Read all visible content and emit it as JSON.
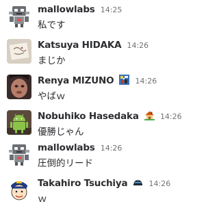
{
  "messages": [
    {
      "user": "mallowlabs",
      "time": "14:25",
      "text": "私です",
      "avatar_icon": "robot-avatar"
    },
    {
      "user": "Katsuya HIDAKA",
      "time": "14:26",
      "text": "まじか",
      "avatar_icon": "sketch-avatar"
    },
    {
      "user": "Renya MIZUNO",
      "time": "14:26",
      "text": "やばｗ",
      "avatar_icon": "photo-avatar",
      "status_icon": "pixel-art-icon"
    },
    {
      "user": "Nobuhiko Hasedaka",
      "time": "14:26",
      "text": "優勝じゃん",
      "avatar_icon": "android-avatar",
      "status_icon": "house-icon"
    },
    {
      "user": "mallowlabs",
      "time": "14:26",
      "text": "圧倒的リード",
      "avatar_icon": "robot-avatar"
    },
    {
      "user": "Takahiro Tsuchiya",
      "time": "14:26",
      "text": "ｗ",
      "avatar_icon": "cartoon-face-avatar",
      "status_icon": "helmet-icon"
    }
  ],
  "colors": {
    "name": "#2c2d30",
    "timestamp": "#717274",
    "android_green": "#8bc34a"
  }
}
